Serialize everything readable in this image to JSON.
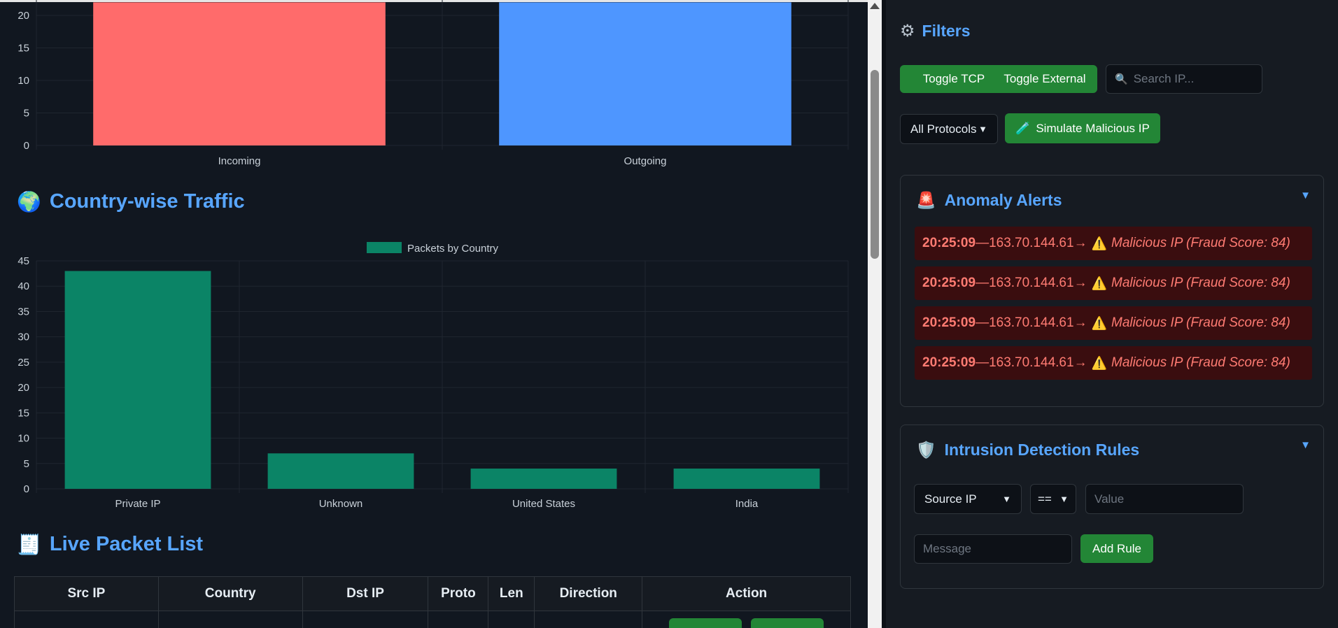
{
  "direction_chart": {
    "categories": [
      "Incoming",
      "Outgoing"
    ],
    "values": [
      22,
      22
    ],
    "colors": [
      "#ff6b6b",
      "#4e96ff"
    ],
    "y_ticks": [
      "0",
      "5",
      "10",
      "15",
      "20"
    ],
    "ylim": [
      0,
      22
    ]
  },
  "country_section": {
    "emoji": "🌍",
    "title": "Country-wise Traffic"
  },
  "chart_data": {
    "type": "bar",
    "categories": [
      "Private IP",
      "Unknown",
      "United States",
      "India"
    ],
    "series": [
      {
        "name": "Packets by Country",
        "values": [
          43,
          7,
          4,
          4
        ],
        "color": "#0b8466"
      }
    ],
    "y_ticks": [
      "0",
      "5",
      "10",
      "15",
      "20",
      "25",
      "30",
      "35",
      "40",
      "45"
    ],
    "ylim": [
      0,
      45
    ],
    "legend": "top-center",
    "grid": true
  },
  "packet_section": {
    "emoji": "🧾",
    "title": "Live Packet List"
  },
  "packet_table": {
    "columns": [
      "Src IP",
      "Country",
      "Dst IP",
      "Proto",
      "Len",
      "Direction",
      "Action"
    ]
  },
  "filters": {
    "gear_glyph": "⚙",
    "title": "Filters",
    "toggle_tcp": "Toggle TCP",
    "toggle_external": "Toggle External",
    "search_placeholder": "Search IP...",
    "protocol_select": "All Protocols",
    "simulate_icon": "🧪",
    "simulate_label": "Simulate Malicious IP"
  },
  "anomaly": {
    "emoji": "🚨",
    "title": "Anomaly Alerts",
    "toggle": "▼",
    "alerts": [
      {
        "time": "20:25:09",
        "sep": " — ",
        "ip": "163.70.144.61",
        "arrow": " →",
        "warn": "⚠️",
        "message": "Malicious IP (Fraud Score: 84)"
      },
      {
        "time": "20:25:09",
        "sep": " — ",
        "ip": "163.70.144.61",
        "arrow": " →",
        "warn": "⚠️",
        "message": "Malicious IP (Fraud Score: 84)"
      },
      {
        "time": "20:25:09",
        "sep": " — ",
        "ip": "163.70.144.61",
        "arrow": " →",
        "warn": "⚠️",
        "message": "Malicious IP (Fraud Score: 84)"
      },
      {
        "time": "20:25:09",
        "sep": " — ",
        "ip": "163.70.144.61",
        "arrow": " →",
        "warn": "⚠️",
        "message": "Malicious IP (Fraud Score: 84)"
      }
    ]
  },
  "rules": {
    "emoji": "🛡️",
    "title": "Intrusion Detection Rules",
    "toggle": "▼",
    "field_select": "Source IP",
    "operator_select": "==",
    "value_placeholder": "Value",
    "message_placeholder": "Message",
    "add_label": "Add Rule"
  },
  "colors": {
    "accent": "#58a6ff",
    "button": "#238636",
    "alert_bg": "#3a0d0f",
    "alert_text": "#ff7b72"
  }
}
